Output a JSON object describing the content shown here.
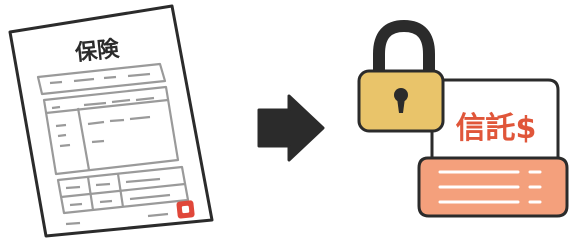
{
  "insurance_doc": {
    "title": "保険"
  },
  "trust_account": {
    "label": "信託$"
  },
  "colors": {
    "outline": "#2b2b2b",
    "doc_lines": "#9a9a9a",
    "stamp_red": "#e0473a",
    "lock_gold": "#e9c46a",
    "trust_label_text": "#e0563a",
    "folder_salmon": "#f4a07c",
    "folder_back": "#ffffff",
    "arrow": "#2b2b2b"
  },
  "icons": {
    "document": "insurance-document-icon",
    "arrow": "arrow-right-icon",
    "lock": "padlock-icon",
    "folder": "trust-folder-icon"
  }
}
